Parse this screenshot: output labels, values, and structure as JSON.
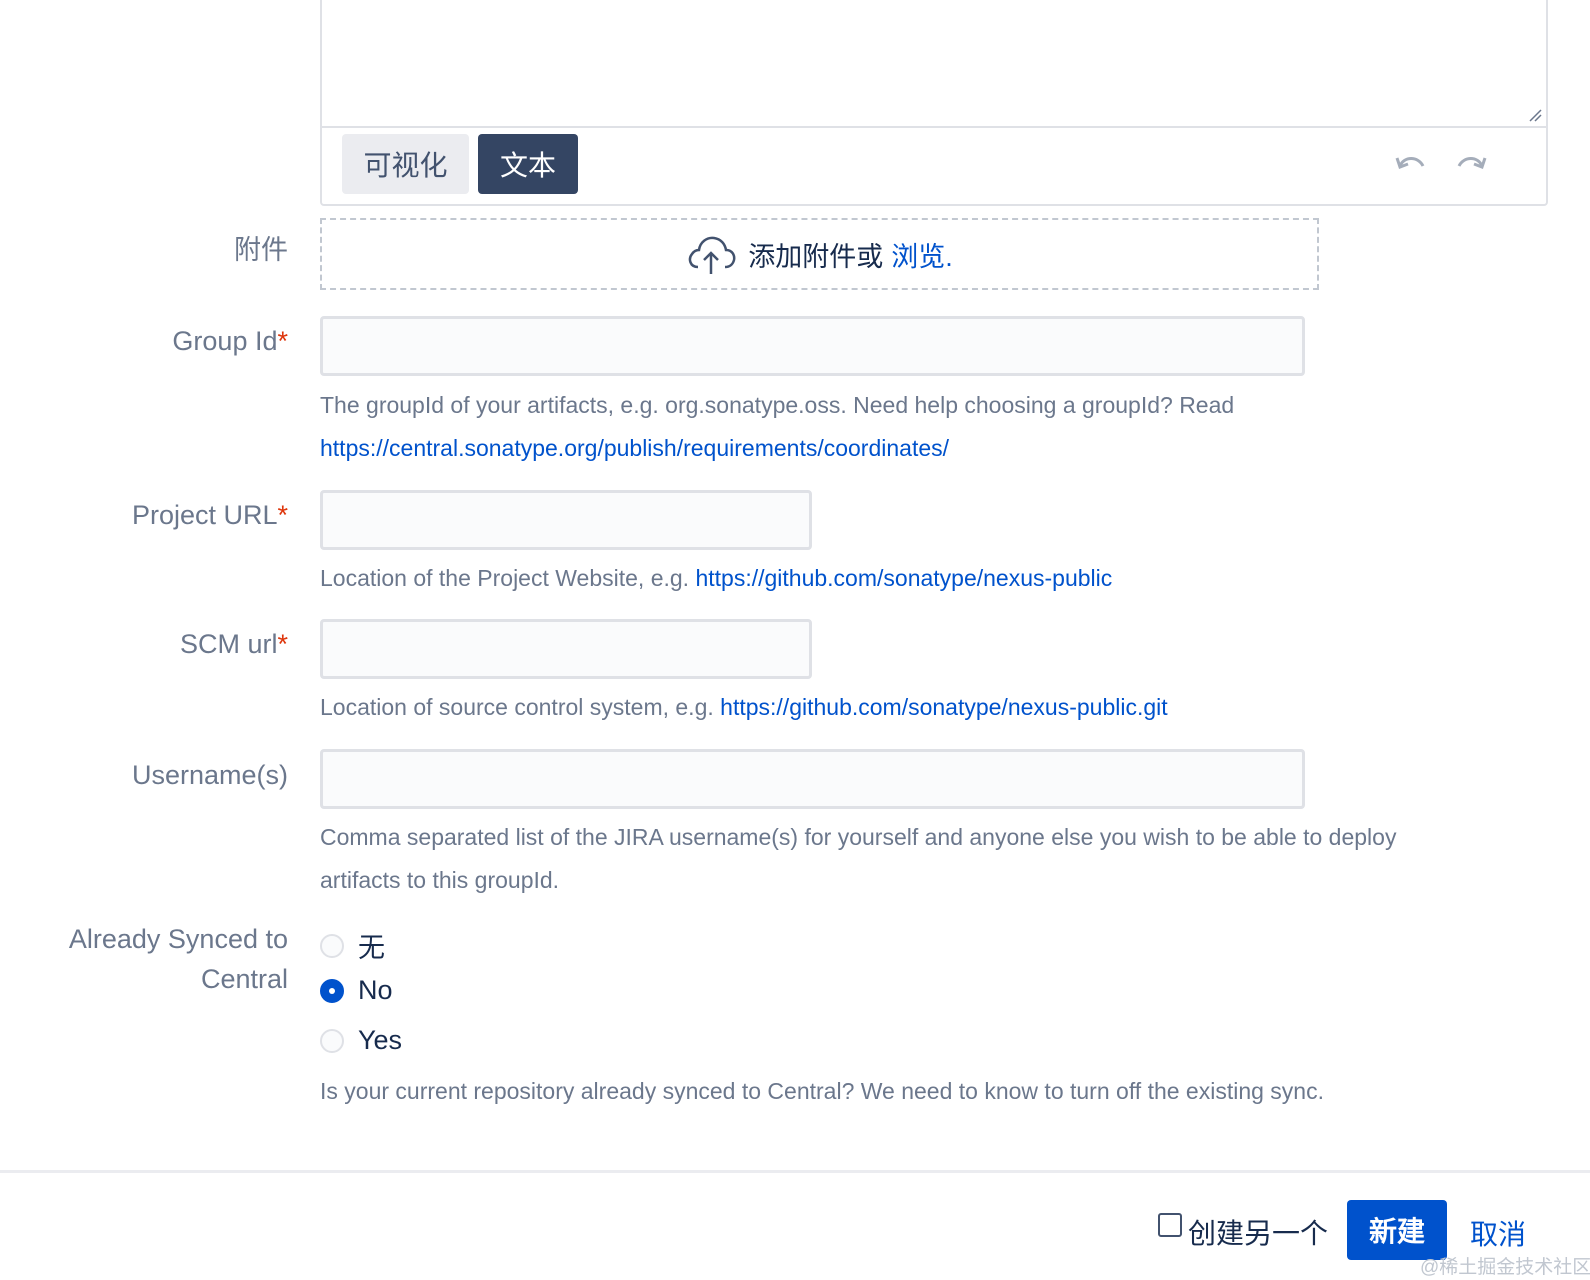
{
  "editor": {
    "mode_visual_label": "可视化",
    "mode_text_label": "文本",
    "active_mode": "文本"
  },
  "attachment": {
    "label": "附件",
    "drop_text": "添加附件或",
    "browse_link": "浏览."
  },
  "fields": {
    "group_id": {
      "label": "Group Id",
      "required_mark": "*",
      "value": "",
      "help_line1": "The groupId of your artifacts, e.g. org.sonatype.oss. Need help choosing a groupId? Read",
      "help_link": "https://central.sonatype.org/publish/requirements/coordinates/"
    },
    "project_url": {
      "label": "Project URL",
      "required_mark": "*",
      "value": "",
      "help_text": "Location of the Project Website, e.g.",
      "help_link": "https://github.com/sonatype/nexus-public"
    },
    "scm_url": {
      "label": "SCM url",
      "required_mark": "*",
      "value": "",
      "help_text": "Location of source control system, e.g.",
      "help_link": "https://github.com/sonatype/nexus-public.git"
    },
    "usernames": {
      "label": "Username(s)",
      "value": "",
      "help_line1": "Comma separated list of the JIRA username(s) for yourself and anyone else you wish to be able to deploy",
      "help_line2": "artifacts to this groupId."
    },
    "synced": {
      "label_line1": "Already Synced to",
      "label_line2": "Central",
      "options": [
        "无",
        "No",
        "Yes"
      ],
      "selected": "No",
      "help_text": "Is your current repository already synced to Central? We need to know to turn off the existing sync."
    }
  },
  "footer": {
    "create_another_label": "创建另一个",
    "create_another_checked": false,
    "create_button": "新建",
    "cancel_link": "取消"
  },
  "watermark": "@稀土掘金技术社区",
  "colors": {
    "primary": "#0052cc",
    "required": "#de350b",
    "editor_active_mode_bg": "#344563"
  }
}
